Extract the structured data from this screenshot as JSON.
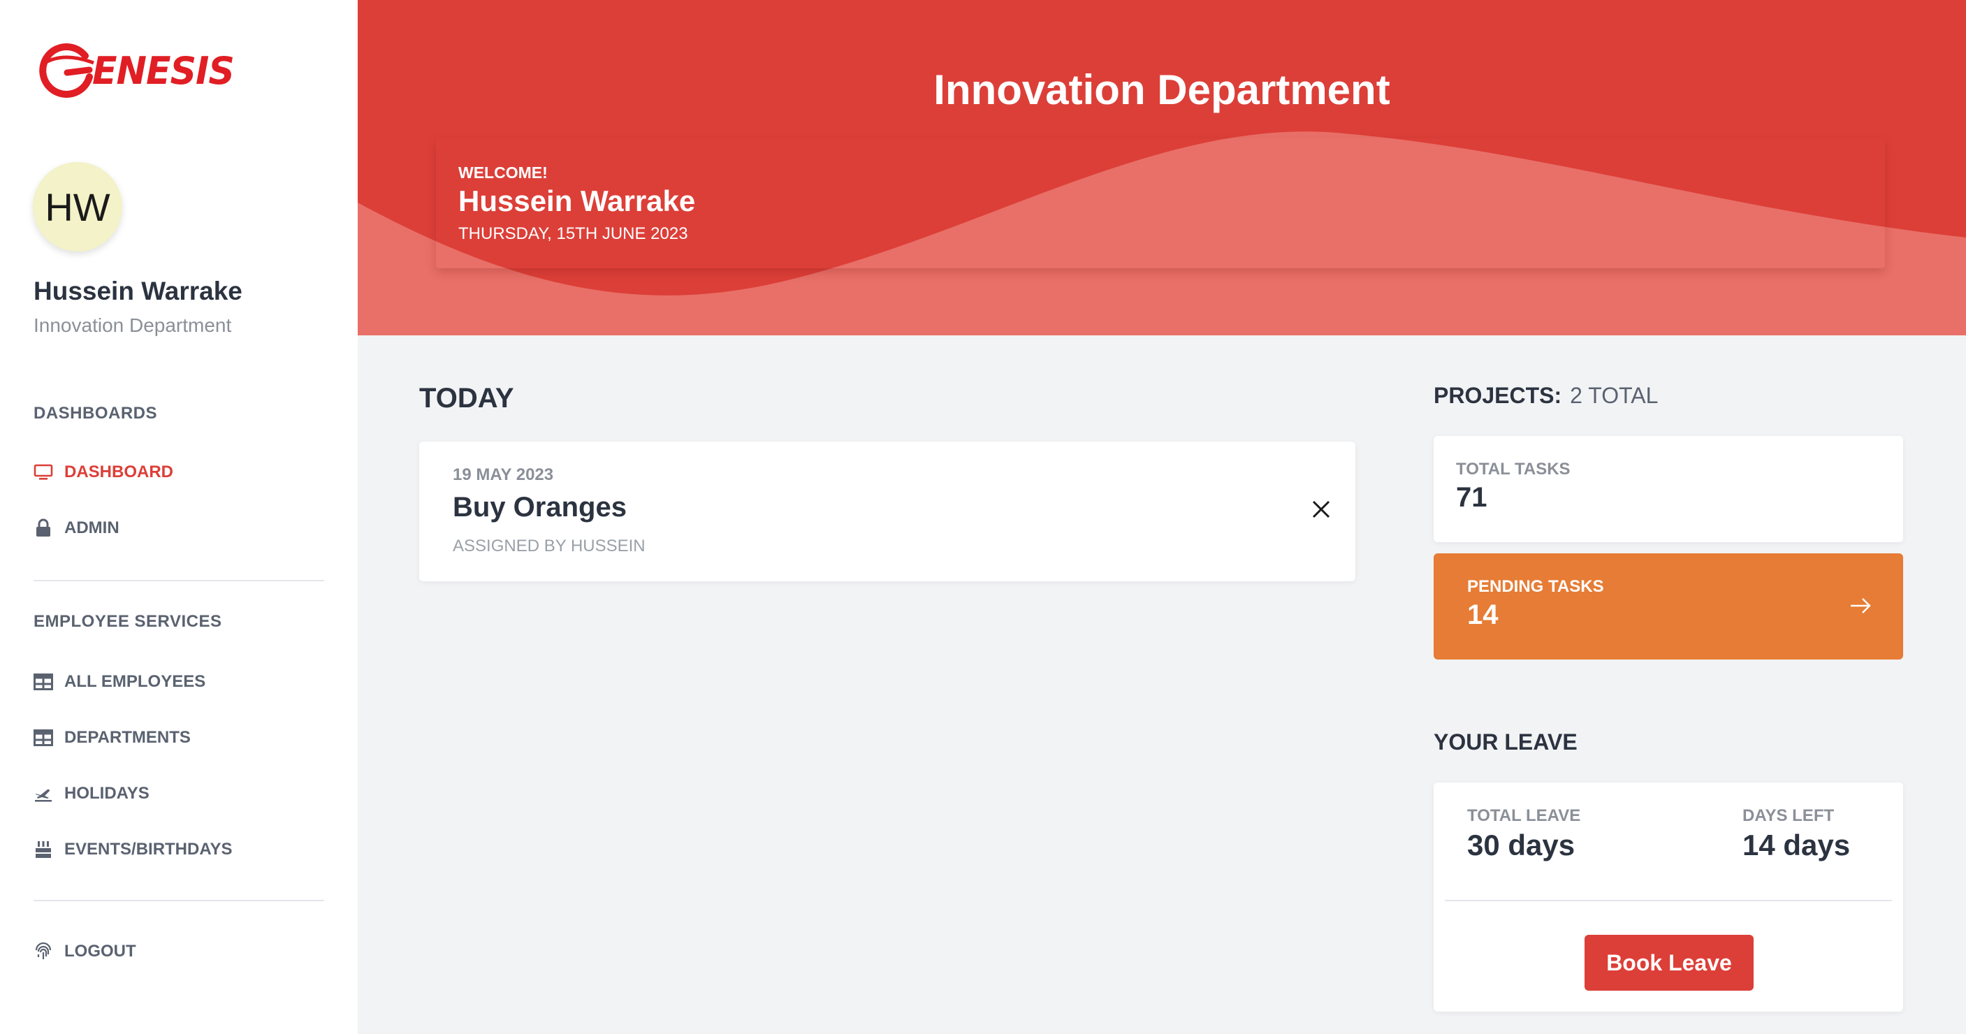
{
  "brand": {
    "logo_text": "ENESIS",
    "accent_color": "#dc3f38",
    "orange_color": "#e67c35"
  },
  "user": {
    "initials": "HW",
    "name": "Hussein Warrake",
    "department": "Innovation Department"
  },
  "sidebar": {
    "sections": [
      {
        "title": "DASHBOARDS"
      },
      {
        "title": "EMPLOYEE SERVICES"
      }
    ],
    "items": [
      {
        "label": "DASHBOARD",
        "icon": "monitor-icon",
        "active": true
      },
      {
        "label": "ADMIN",
        "icon": "lock-icon"
      },
      {
        "label": "ALL EMPLOYEES",
        "icon": "table-icon"
      },
      {
        "label": "DEPARTMENTS",
        "icon": "table-icon"
      },
      {
        "label": "HOLIDAYS",
        "icon": "plane-icon"
      },
      {
        "label": "EVENTS/BIRTHDAYS",
        "icon": "cake-icon"
      },
      {
        "label": "LOGOUT",
        "icon": "fingerprint-icon"
      }
    ]
  },
  "header": {
    "title": "Innovation Department",
    "welcome_label": "WELCOME!",
    "welcome_name": "Hussein Warrake",
    "date": "THURSDAY, 15TH JUNE 2023"
  },
  "today": {
    "title": "TODAY",
    "tasks": [
      {
        "date": "19 MAY 2023",
        "title": "Buy Oranges",
        "assigned": "ASSIGNED BY HUSSEIN"
      }
    ]
  },
  "projects": {
    "title": "PROJECTS:",
    "total": "2 TOTAL",
    "total_tasks_label": "TOTAL TASKS",
    "total_tasks_value": "71",
    "pending_tasks_label": "PENDING TASKS",
    "pending_tasks_value": "14"
  },
  "leave": {
    "title": "YOUR LEAVE",
    "total_label": "TOTAL LEAVE",
    "total_value": "30 days",
    "left_label": "DAYS LEFT",
    "left_value": "14 days",
    "button_label": "Book Leave"
  }
}
